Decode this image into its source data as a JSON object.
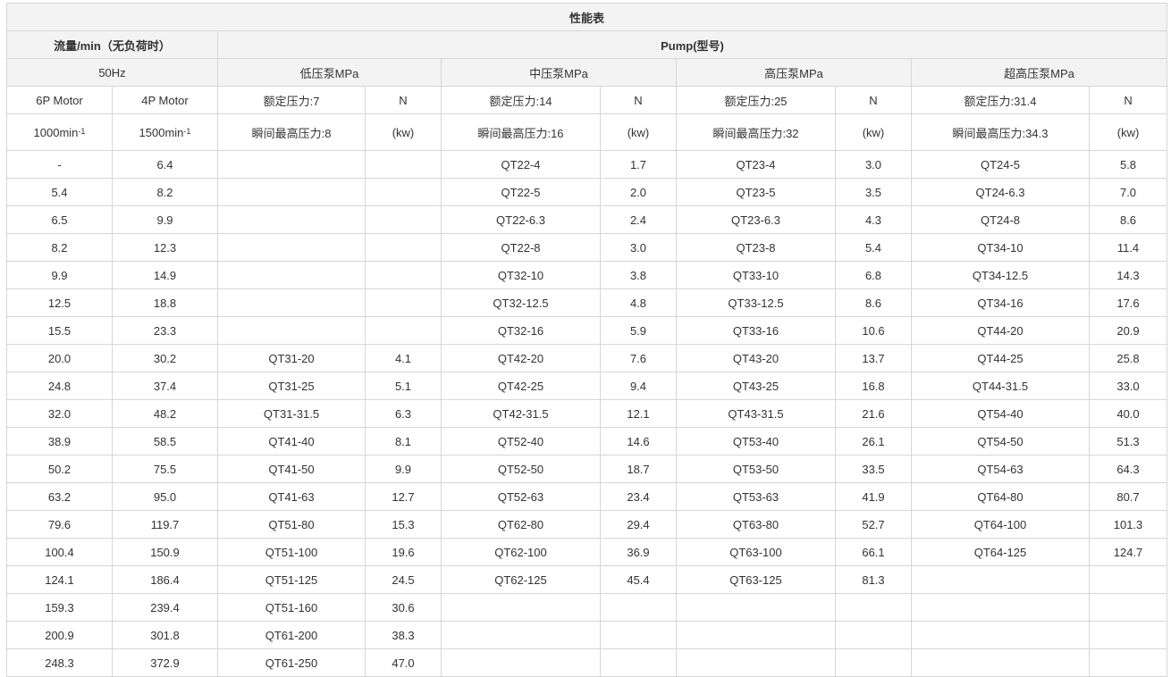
{
  "title": "性能表",
  "flow_header": "流量/min（无负荷时）",
  "pump_header": "Pump(型号)",
  "freq": "50Hz",
  "groups": [
    {
      "name": "低压泵MPa",
      "rated": "额定压力:7",
      "peak": "瞬间最高压力:8"
    },
    {
      "name": "中压泵MPa",
      "rated": "额定压力:14",
      "peak": "瞬间最高压力:16"
    },
    {
      "name": "高压泵MPa",
      "rated": "额定压力:25",
      "peak": "瞬间最高压力:32"
    },
    {
      "name": "超高压泵MPa",
      "rated": "额定压力:31.4",
      "peak": "瞬间最高压力:34.3"
    }
  ],
  "n_label": "N",
  "kw_label": "(kw)",
  "motor_6p": "6P Motor",
  "motor_4p": "4P Motor",
  "speed_6p": "1000min",
  "speed_4p": "1500min",
  "speed_exp": "-1",
  "rows": [
    [
      "-",
      "6.4",
      "",
      "",
      "QT22-4",
      "1.7",
      "QT23-4",
      "3.0",
      "QT24-5",
      "5.8"
    ],
    [
      "5.4",
      "8.2",
      "",
      "",
      "QT22-5",
      "2.0",
      "QT23-5",
      "3.5",
      "QT24-6.3",
      "7.0"
    ],
    [
      "6.5",
      "9.9",
      "",
      "",
      "QT22-6.3",
      "2.4",
      "QT23-6.3",
      "4.3",
      "QT24-8",
      "8.6"
    ],
    [
      "8.2",
      "12.3",
      "",
      "",
      "QT22-8",
      "3.0",
      "QT23-8",
      "5.4",
      "QT34-10",
      "11.4"
    ],
    [
      "9.9",
      "14.9",
      "",
      "",
      "QT32-10",
      "3.8",
      "QT33-10",
      "6.8",
      "QT34-12.5",
      "14.3"
    ],
    [
      "12.5",
      "18.8",
      "",
      "",
      "QT32-12.5",
      "4.8",
      "QT33-12.5",
      "8.6",
      "QT34-16",
      "17.6"
    ],
    [
      "15.5",
      "23.3",
      "",
      "",
      "QT32-16",
      "5.9",
      "QT33-16",
      "10.6",
      "QT44-20",
      "20.9"
    ],
    [
      "20.0",
      "30.2",
      "QT31-20",
      "4.1",
      "QT42-20",
      "7.6",
      "QT43-20",
      "13.7",
      "QT44-25",
      "25.8"
    ],
    [
      "24.8",
      "37.4",
      "QT31-25",
      "5.1",
      "QT42-25",
      "9.4",
      "QT43-25",
      "16.8",
      "QT44-31.5",
      "33.0"
    ],
    [
      "32.0",
      "48.2",
      "QT31-31.5",
      "6.3",
      "QT42-31.5",
      "12.1",
      "QT43-31.5",
      "21.6",
      "QT54-40",
      "40.0"
    ],
    [
      "38.9",
      "58.5",
      "QT41-40",
      "8.1",
      "QT52-40",
      "14.6",
      "QT53-40",
      "26.1",
      "QT54-50",
      "51.3"
    ],
    [
      "50.2",
      "75.5",
      "QT41-50",
      "9.9",
      "QT52-50",
      "18.7",
      "QT53-50",
      "33.5",
      "QT54-63",
      "64.3"
    ],
    [
      "63.2",
      "95.0",
      "QT41-63",
      "12.7",
      "QT52-63",
      "23.4",
      "QT53-63",
      "41.9",
      "QT64-80",
      "80.7"
    ],
    [
      "79.6",
      "119.7",
      "QT51-80",
      "15.3",
      "QT62-80",
      "29.4",
      "QT63-80",
      "52.7",
      "QT64-100",
      "101.3"
    ],
    [
      "100.4",
      "150.9",
      "QT51-100",
      "19.6",
      "QT62-100",
      "36.9",
      "QT63-100",
      "66.1",
      "QT64-125",
      "124.7"
    ],
    [
      "124.1",
      "186.4",
      "QT51-125",
      "24.5",
      "QT62-125",
      "45.4",
      "QT63-125",
      "81.3",
      "",
      ""
    ],
    [
      "159.3",
      "239.4",
      "QT51-160",
      "30.6",
      "",
      "",
      "",
      "",
      "",
      ""
    ],
    [
      "200.9",
      "301.8",
      "QT61-200",
      "38.3",
      "",
      "",
      "",
      "",
      "",
      ""
    ],
    [
      "248.3",
      "372.9",
      "QT61-250",
      "47.0",
      "",
      "",
      "",
      "",
      "",
      ""
    ]
  ]
}
